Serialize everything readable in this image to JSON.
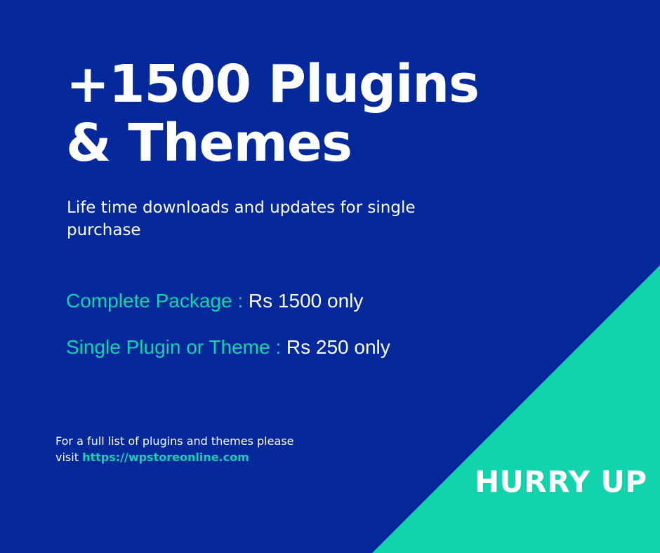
{
  "banner": {
    "headline": {
      "line1": "+1500 Plugins",
      "line2": "& Themes"
    },
    "subtitle": "Life time downloads and updates for single purchase",
    "pricing": [
      {
        "label": "Complete Package : ",
        "value": "Rs 1500 only"
      },
      {
        "label": "Single Plugin or Theme : ",
        "value": "Rs 250 only"
      }
    ],
    "footer": {
      "line1": "For a full list of plugins and themes please",
      "visit_text": "visit ",
      "link_text": "https://wpstoreonline.com"
    },
    "cta": "HURRY UP"
  },
  "colors": {
    "background": "#05299a",
    "accent": "#11d3ac",
    "text": "#ffffff"
  }
}
